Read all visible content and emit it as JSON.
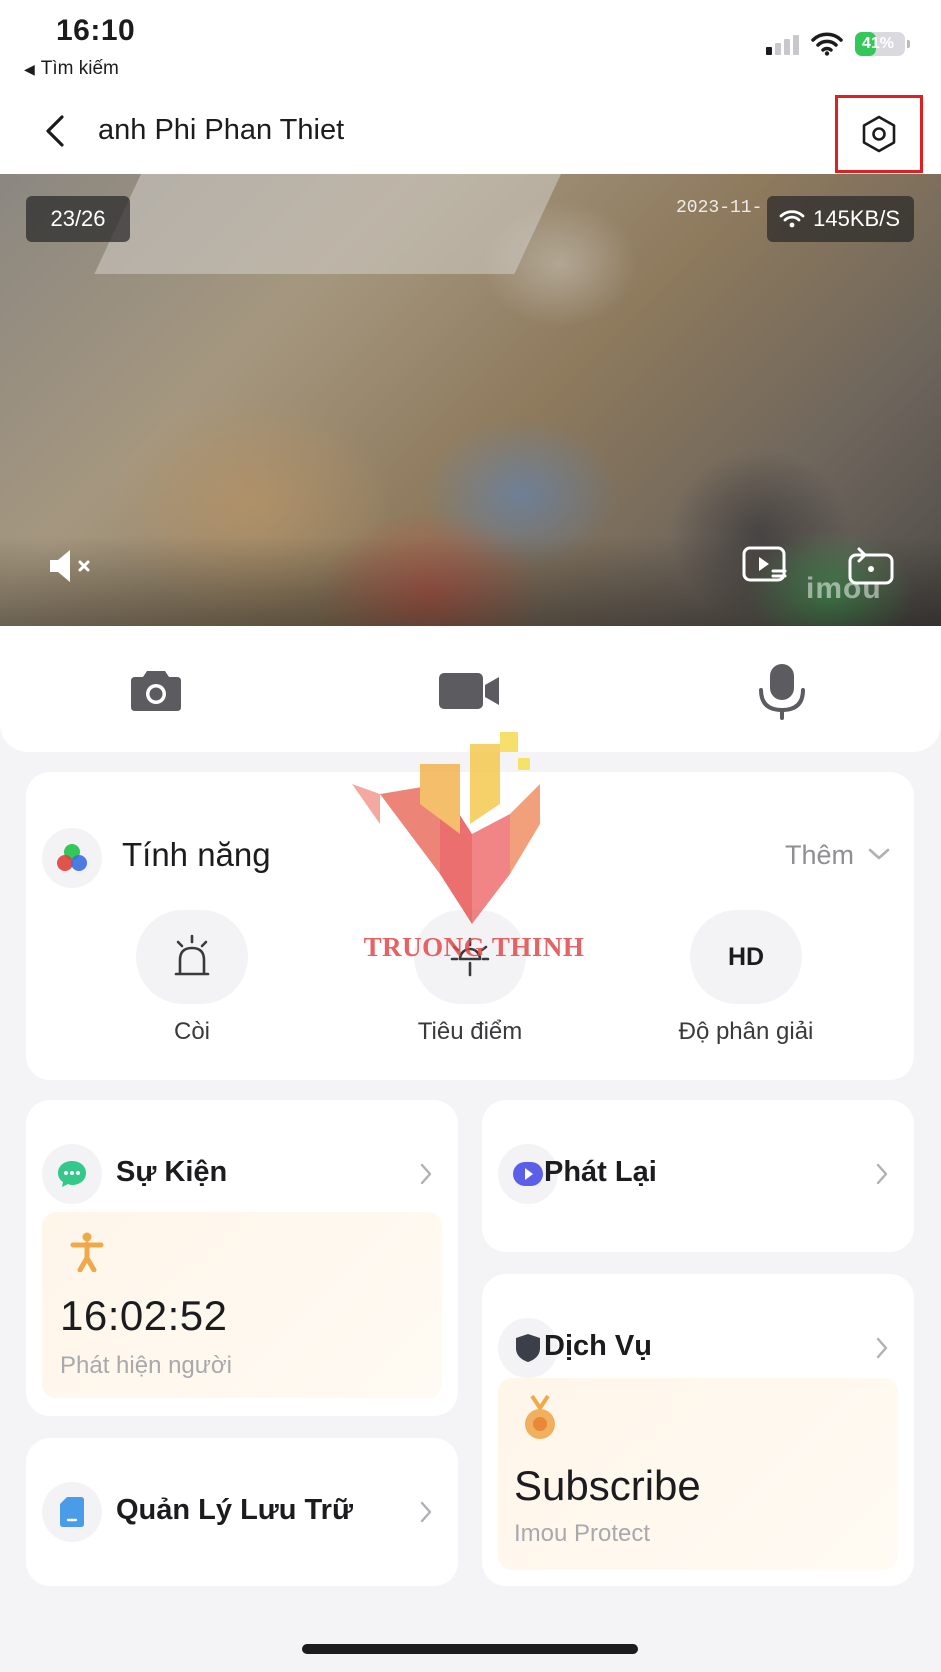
{
  "status_bar": {
    "time": "16:10",
    "back_app_label": "Tìm kiếm",
    "battery_percent": "41%",
    "battery_level": 0.41,
    "colors": {
      "battery": "#34c759"
    }
  },
  "header": {
    "title": "anh Phi Phan Thiet",
    "back_icon": "chevron-left-icon",
    "settings_icon": "settings-hexagon-icon",
    "highlight_color": "#e02020"
  },
  "video": {
    "counter": "23/26",
    "osd_date": "2023-11-",
    "speed": "145KB/S",
    "brand_watermark": "imou"
  },
  "controls": {
    "snapshot_icon": "camera-icon",
    "record_icon": "video-camera-icon",
    "talk_icon": "microphone-icon"
  },
  "features": {
    "title": "Tính năng",
    "more_label": "Thêm",
    "items": [
      {
        "label": "Còi",
        "icon": "siren-icon"
      },
      {
        "label": "Tiêu điểm",
        "icon": "spotlight-icon"
      },
      {
        "label": "Độ phân giải",
        "icon_text": "HD"
      }
    ]
  },
  "events": {
    "title": "Sự Kiện",
    "latest_time": "16:02:52",
    "latest_desc": "Phát hiện người"
  },
  "playback": {
    "title": "Phát Lại"
  },
  "service": {
    "title": "Dịch Vụ",
    "promo_title": "Subscribe",
    "promo_sub": "Imou Protect"
  },
  "storage": {
    "title": "Quản Lý Lưu Trữ"
  },
  "overlay_watermark": {
    "text": "TRUONG THINH"
  }
}
